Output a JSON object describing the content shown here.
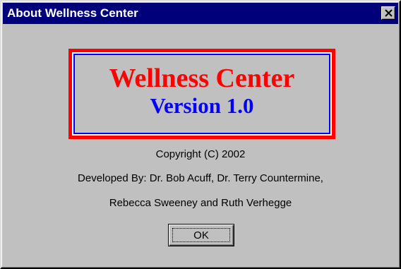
{
  "window": {
    "title": "About Wellness Center",
    "close_icon": "close-icon"
  },
  "logo": {
    "app_name": "Wellness Center",
    "version": "Version 1.0",
    "colors": {
      "name": "#ff0000",
      "version": "#0000ff",
      "frame_outer": "#ff0000",
      "frame_inner": "#0000ff"
    }
  },
  "info": {
    "copyright": "Copyright (C) 2002",
    "developers_line1": "Developed By: Dr. Bob Acuff, Dr. Terry Countermine,",
    "developers_line2": "Rebecca Sweeney and Ruth Verhegge"
  },
  "buttons": {
    "ok_label": "OK"
  },
  "colors": {
    "titlebar": "#00007b",
    "face": "#c0c0c0"
  }
}
